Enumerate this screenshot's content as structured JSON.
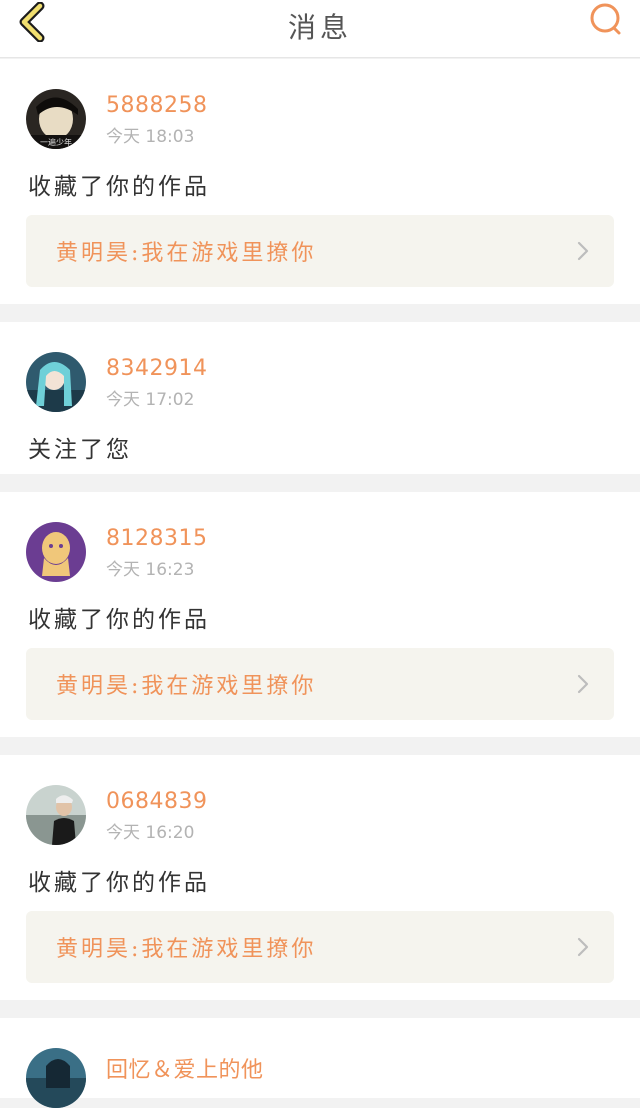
{
  "header": {
    "title": "消息",
    "back_icon": "chevron-left-icon",
    "search_icon": "search-icon",
    "accent": "#f0935a"
  },
  "notifications": [
    {
      "username": "5888258",
      "time": "今天 18:03",
      "action": "收藏了你的作品",
      "work_title": "黄明昊:我在游戏里撩你"
    },
    {
      "username": "8342914",
      "time": "今天 17:02",
      "action": "关注了您"
    },
    {
      "username": "8128315",
      "time": "今天 16:23",
      "action": "收藏了你的作品",
      "work_title": "黄明昊:我在游戏里撩你"
    },
    {
      "username": "0684839",
      "time": "今天 16:20",
      "action": "收藏了你的作品",
      "work_title": "黄明昊:我在游戏里撩你"
    },
    {
      "username": "回忆＆爱上的他"
    }
  ]
}
